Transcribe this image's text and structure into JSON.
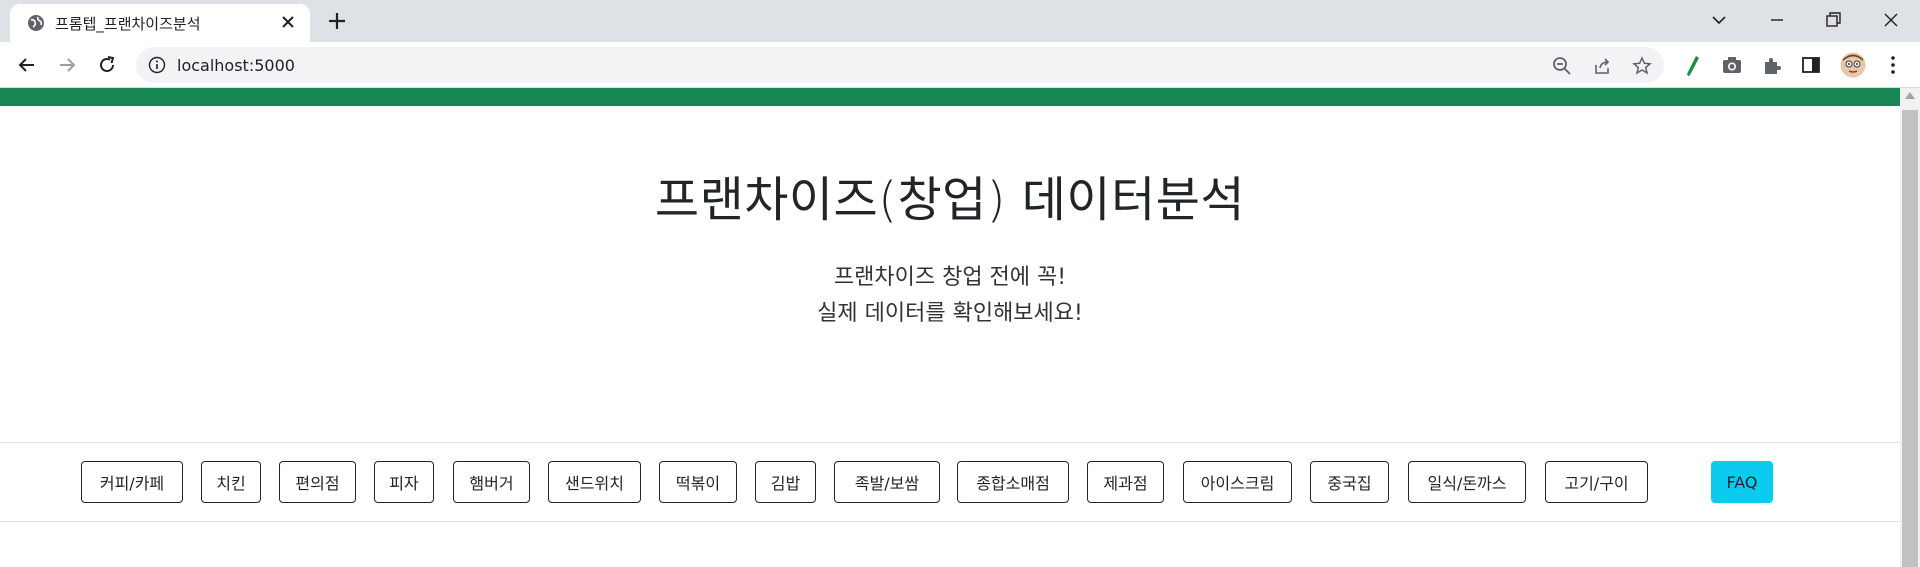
{
  "browser": {
    "tab_title": "프롬텝_프랜차이즈분석",
    "url": "localhost:5000"
  },
  "page": {
    "title": "프랜차이즈(창업) 데이터분석",
    "lead_line1": "프랜차이즈 창업 전에 꼭!",
    "lead_line2": "실제 데이터를 확인해보세요!"
  },
  "categories": [
    "커피/카페",
    "치킨",
    "편의점",
    "피자",
    "햄버거",
    "샌드위치",
    "떡볶이",
    "김밥",
    "족발/보쌈",
    "종합소매점",
    "제과점",
    "아이스크림",
    "중국집",
    "일식/돈까스",
    "고기/구이"
  ],
  "faq_label": "FAQ",
  "colors": {
    "topbar": "#198754",
    "faq": "#0dcaf0"
  }
}
